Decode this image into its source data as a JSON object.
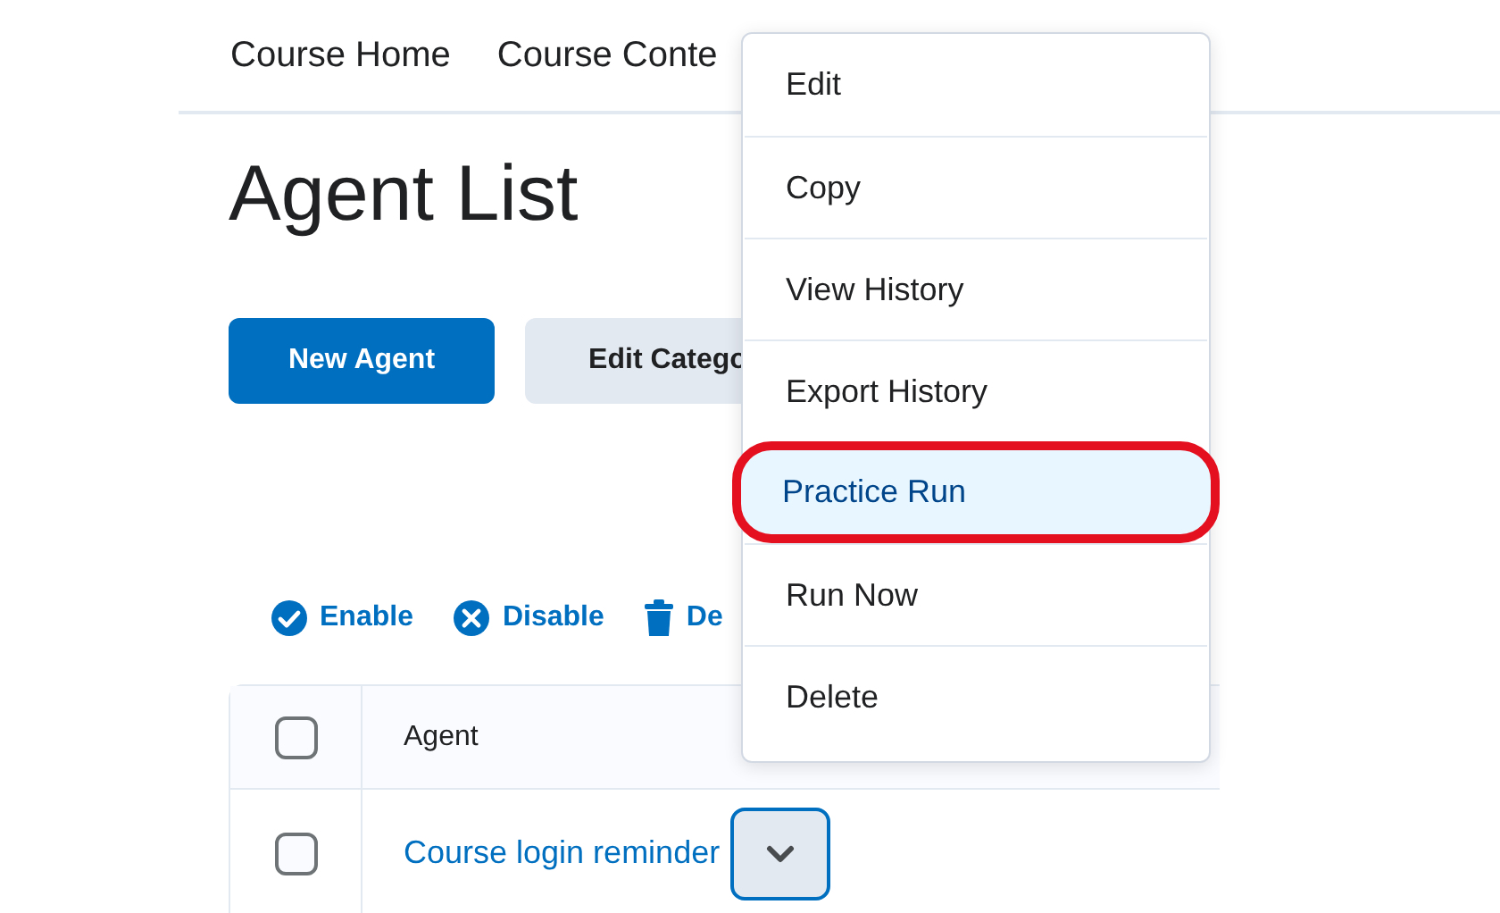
{
  "nav": [
    "Course Home",
    "Course Conte"
  ],
  "title": "Agent List",
  "buttons": [
    {
      "label": "New Agent",
      "kind": "primary"
    },
    {
      "label": "Edit Catego",
      "kind": "secondary"
    }
  ],
  "actions": [
    {
      "label": "Enable",
      "kind": "check"
    },
    {
      "label": "Disable",
      "kind": "cross"
    },
    {
      "label": "De",
      "kind": "trash"
    }
  ],
  "table": {
    "columns": [
      {
        "kind": "checkbox",
        "checked": false
      },
      {
        "label": "Agent"
      }
    ],
    "rows": [
      {
        "checked": false,
        "name": "Course login reminder"
      }
    ]
  },
  "menu": {
    "items": [
      {
        "label": "Edit",
        "highlighted": false
      },
      {
        "label": "Copy",
        "highlighted": false
      },
      {
        "label": "View History",
        "highlighted": false
      },
      {
        "label": "Export History",
        "highlighted": false
      },
      {
        "label": "Practice Run",
        "highlighted": true
      },
      {
        "label": "Run Now",
        "highlighted": false
      },
      {
        "label": "Delete",
        "highlighted": false
      }
    ]
  }
}
